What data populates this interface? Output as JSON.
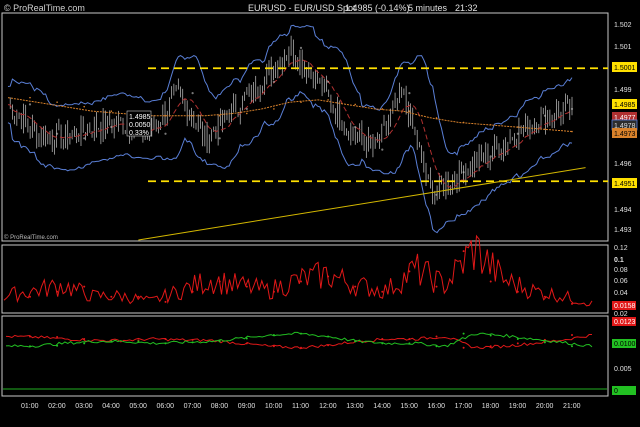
{
  "watermark_top": "© ProRealTime.com",
  "watermark_bottom": "© ProRealTime.com",
  "header": {
    "instrument": "EURUSD - EUR/USD Spot",
    "last": "1.4985 (-0.14%)",
    "timeframe": "5 minutes",
    "time": "21:32"
  },
  "colors": {
    "background": "#000000",
    "border": "#c8c8c8",
    "candle": "#c8c8c8",
    "bollinger": "#5a7fd6",
    "ma_slow": "#d9822b",
    "ma_fast": "#b03030",
    "level_line": "#ffe000",
    "trend_line": "#d4b800",
    "indicator_red": "#e01818",
    "indicator_green": "#22c022",
    "panel_green_line": "#22b022"
  },
  "info_box": [
    "1.4985",
    "0.0050",
    "0.33%"
  ],
  "price_labels": {
    "ticks": [
      "1.502",
      "1.501",
      "1.499",
      "1.496",
      "1.494",
      "1.493"
    ],
    "level_high": "1.5001",
    "level_low": "1.4951",
    "last": "1.4985",
    "ma_fast": "1.4977",
    "bollinger_mid": "1.4978",
    "ma_slow": "1.4973"
  },
  "panel2": {
    "ticks": [
      "0.12",
      "0.1",
      "0.08",
      "0.06",
      "0.04",
      "0.02"
    ],
    "last_label": "0.0158"
  },
  "panel3": {
    "ticks": [
      "0.005"
    ],
    "red_label": "0.0123",
    "green_label": "0.0100",
    "bottom_label": "0"
  },
  "time_axis": [
    "01:00",
    "02:00",
    "03:00",
    "04:00",
    "05:00",
    "06:00",
    "07:00",
    "08:00",
    "09:00",
    "10:00",
    "11:00",
    "12:00",
    "13:00",
    "14:00",
    "15:00",
    "16:00",
    "17:00",
    "18:00",
    "19:00",
    "20:00",
    "21:00"
  ],
  "chart_data": {
    "type": "line",
    "title": "EURUSD - EUR/USD Spot",
    "x": [
      "01:00",
      "02:00",
      "03:00",
      "04:00",
      "05:00",
      "06:00",
      "07:00",
      "08:00",
      "09:00",
      "10:00",
      "11:00",
      "12:00",
      "13:00",
      "14:00",
      "15:00",
      "16:00",
      "17:00",
      "18:00",
      "19:00",
      "20:00",
      "21:00"
    ],
    "ylim": [
      1.4925,
      1.5025
    ],
    "series": [
      {
        "values": [
          1.4985,
          1.4972,
          1.497,
          1.4975,
          1.4977,
          1.4972,
          1.499,
          1.497,
          1.4983,
          1.4995,
          1.501,
          1.4995,
          1.4975,
          1.4965,
          1.499,
          1.4945,
          1.4955,
          1.4962,
          1.4972,
          1.498,
          1.4983
        ]
      },
      {
        "values": [
          1.4988,
          1.4986,
          1.4984,
          1.4982,
          1.4981,
          1.498,
          1.498,
          1.498,
          1.4981,
          1.4983,
          1.4986,
          1.4987,
          1.4985,
          1.4983,
          1.4982,
          1.4979,
          1.4977,
          1.4976,
          1.4975,
          1.4974,
          1.4973
        ]
      }
    ],
    "horizontal_levels": [
      1.5001,
      1.4951
    ],
    "trend_line": {
      "start": [
        "05:00",
        1.4925
      ],
      "end": [
        "21:30",
        1.4957
      ]
    },
    "panels": [
      {
        "type": "line",
        "ylim": [
          0,
          0.13
        ],
        "series": [
          {
            "values": [
              0.03,
              0.04,
              0.05,
              0.03,
              0.03,
              0.02,
              0.04,
              0.06,
              0.05,
              0.04,
              0.06,
              0.07,
              0.05,
              0.04,
              0.08,
              0.05,
              0.12,
              0.06,
              0.04,
              0.03,
              0.016
            ]
          }
        ]
      },
      {
        "type": "line",
        "ylim": [
          0,
          0.016
        ],
        "series": [
          {
            "values": [
              0.012,
              0.0119,
              0.0115,
              0.0112,
              0.0112,
              0.0115,
              0.0113,
              0.0112,
              0.0106,
              0.01,
              0.0097,
              0.0102,
              0.011,
              0.0115,
              0.0115,
              0.012,
              0.0097,
              0.01,
              0.0106,
              0.0113,
              0.0123
            ]
          },
          {
            "values": [
              0.01,
              0.0101,
              0.0106,
              0.011,
              0.011,
              0.0106,
              0.0108,
              0.011,
              0.0116,
              0.0123,
              0.0126,
              0.012,
              0.011,
              0.0106,
              0.0106,
              0.01,
              0.0126,
              0.0122,
              0.0115,
              0.0108,
              0.01
            ]
          }
        ]
      }
    ]
  }
}
